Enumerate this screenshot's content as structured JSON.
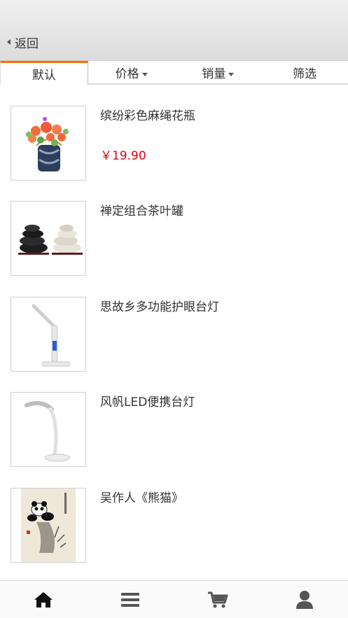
{
  "header": {
    "back_label": "返回"
  },
  "tabs": [
    {
      "label": "默认",
      "active": true,
      "has_caret": false
    },
    {
      "label": "价格",
      "active": false,
      "has_caret": true
    },
    {
      "label": "销量",
      "active": false,
      "has_caret": true
    },
    {
      "label": "筛选",
      "active": false,
      "has_caret": false
    }
  ],
  "products": [
    {
      "title": "缤纷彩色麻绳花瓶",
      "price": "￥19.90",
      "image": "flower-vase"
    },
    {
      "title": "禅定组合茶叶罐",
      "price": "",
      "image": "zen-stones"
    },
    {
      "title": "思故乡多功能护眼台灯",
      "price": "",
      "image": "desk-lamp"
    },
    {
      "title": "风帆LED便携台灯",
      "price": "",
      "image": "led-lamp"
    },
    {
      "title": "吴作人《熊猫》",
      "price": "",
      "image": "panda-painting"
    }
  ],
  "bottom_nav": [
    {
      "icon": "home-icon"
    },
    {
      "icon": "menu-icon"
    },
    {
      "icon": "cart-icon"
    },
    {
      "icon": "user-icon"
    }
  ],
  "colors": {
    "accent": "#ff6a00",
    "price": "#e60012",
    "icon": "#555555"
  }
}
